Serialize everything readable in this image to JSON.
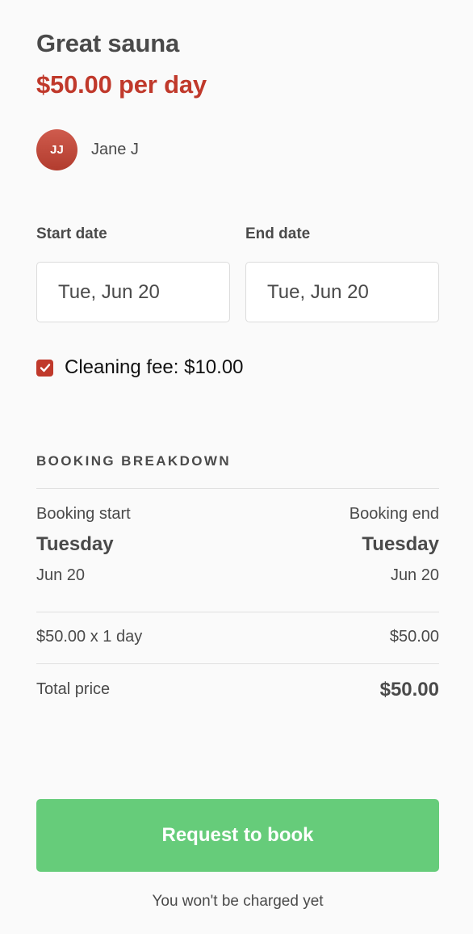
{
  "listing": {
    "title": "Great sauna",
    "price": "$50.00 per day"
  },
  "author": {
    "initials": "JJ",
    "name": "Jane J"
  },
  "dates": {
    "start_label": "Start date",
    "start_value": "Tue, Jun 20",
    "end_label": "End date",
    "end_value": "Tue, Jun 20"
  },
  "cleaning_fee": {
    "label": "Cleaning fee: $10.00",
    "checked": true
  },
  "breakdown": {
    "heading": "Booking breakdown",
    "start_label": "Booking start",
    "start_day": "Tuesday",
    "start_date": "Jun 20",
    "end_label": "Booking end",
    "end_day": "Tuesday",
    "end_date": "Jun 20",
    "line_item_label": "$50.00 x 1 day",
    "line_item_value": "$50.00",
    "total_label": "Total price",
    "total_value": "$50.00"
  },
  "actions": {
    "book_label": "Request to book",
    "note": "You won't be charged yet"
  },
  "colors": {
    "accent": "#c0392b",
    "button": "#66cc7a",
    "text": "#4a4a4a"
  }
}
